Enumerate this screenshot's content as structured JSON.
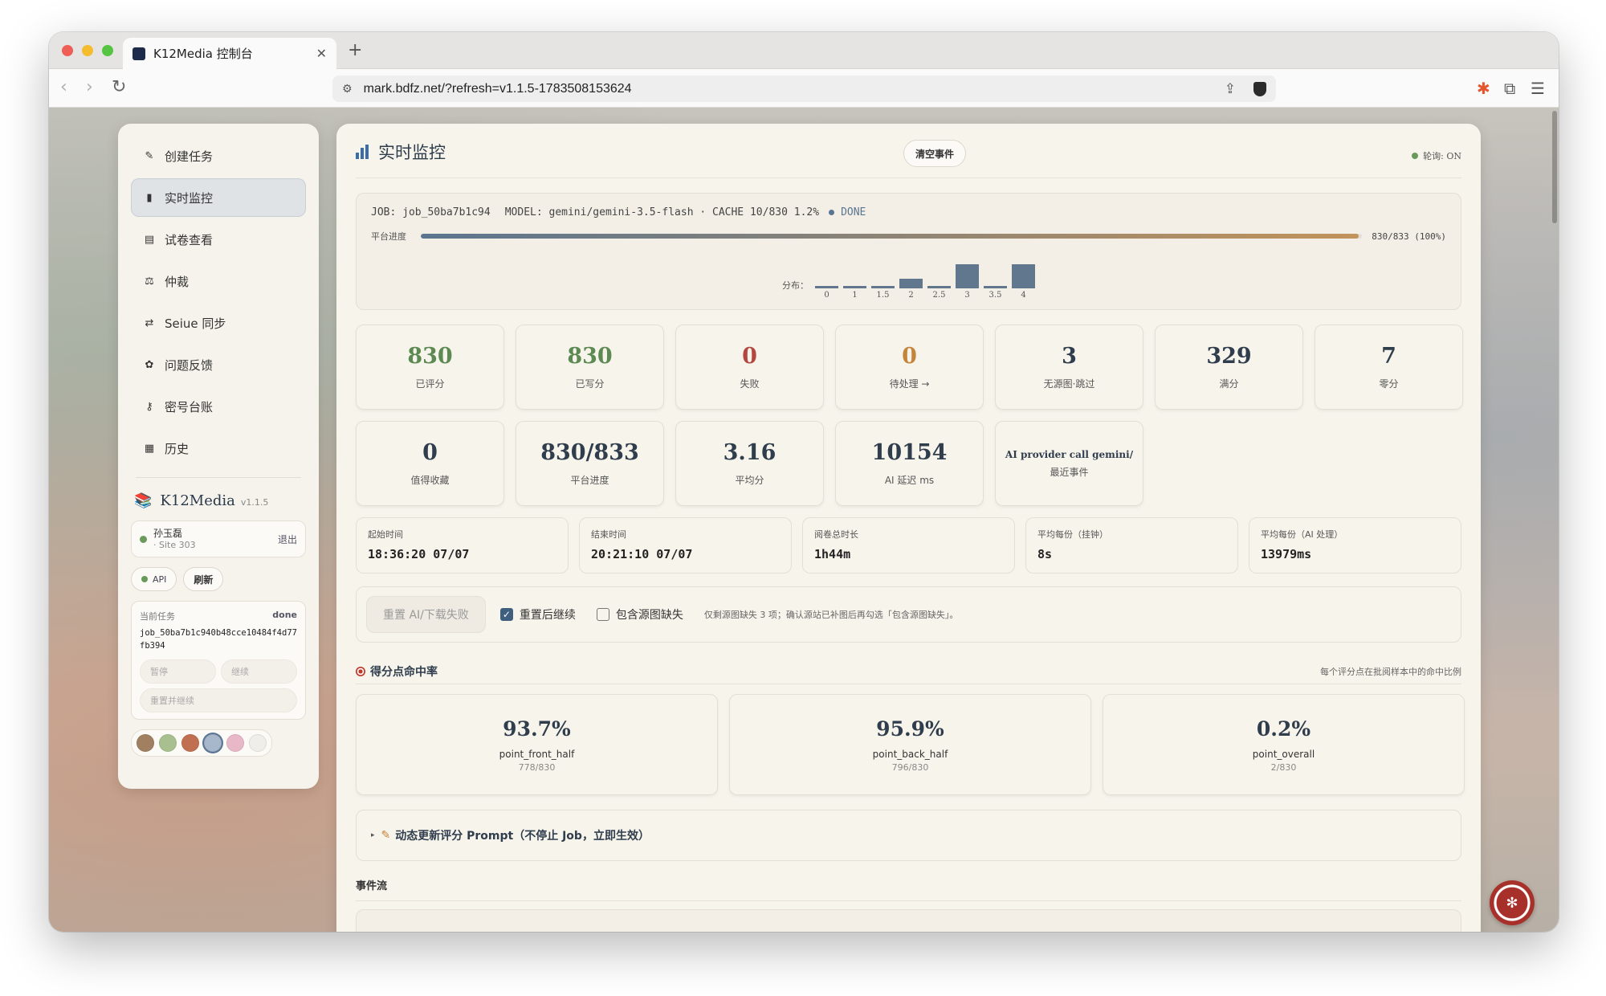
{
  "browser": {
    "tab_title": "K12Media 控制台",
    "url": "mark.bdfz.net/?refresh=v1.1.5-1783508153624"
  },
  "sidebar": {
    "items": [
      {
        "label": "创建任务",
        "icon": "pencil-icon"
      },
      {
        "label": "实时监控",
        "icon": "bar-chart-icon",
        "active": true
      },
      {
        "label": "试卷查看",
        "icon": "paper-icon"
      },
      {
        "label": "仲裁",
        "icon": "scale-icon"
      },
      {
        "label": "Seiue 同步",
        "icon": "sync-icon"
      },
      {
        "label": "问题反馈",
        "icon": "bug-icon"
      },
      {
        "label": "密号台账",
        "icon": "key-icon"
      },
      {
        "label": "历史",
        "icon": "history-icon"
      }
    ],
    "brand": {
      "name": "K12Media",
      "version": "v1.1.5"
    },
    "user": {
      "name": "孙玉磊",
      "site": "· Site 303",
      "logout": "退出"
    },
    "api_label": "API",
    "refresh_label": "刷新",
    "task": {
      "label": "当前任务",
      "status": "done",
      "id": "job_50ba7b1c940b48cce10484f4d77fb394",
      "pause": "暂停",
      "resume": "继续",
      "reset_resume": "重置并继续"
    },
    "swatches": [
      "#a08060",
      "#a8c090",
      "#c07050",
      "#a8b8cc",
      "#e8b8c8",
      "#f0eee8"
    ]
  },
  "main": {
    "title": "实时监控",
    "clear_events": "清空事件",
    "poll": "轮询: ON",
    "job": {
      "job": "JOB: job_50ba7b1c94",
      "model": "MODEL: gemini/gemini-3.5-flash · CACHE 10/830 1.2%",
      "status": "DONE",
      "progress_label": "平台进度",
      "progress_text": "830/833 (100%)",
      "progress_fraction": 0.996,
      "dist_label": "分布："
    },
    "stats": [
      {
        "value": "830",
        "label": "已评分",
        "tone": "green"
      },
      {
        "value": "830",
        "label": "已写分",
        "tone": "green"
      },
      {
        "value": "0",
        "label": "失败",
        "tone": "red"
      },
      {
        "value": "0",
        "label": "待处理 →",
        "tone": "orange"
      },
      {
        "value": "3",
        "label": "无源图·跳过",
        "tone": ""
      },
      {
        "value": "329",
        "label": "满分",
        "tone": ""
      },
      {
        "value": "7",
        "label": "零分",
        "tone": ""
      },
      {
        "value": "0",
        "label": "值得收藏",
        "tone": ""
      },
      {
        "value": "830/833",
        "label": "平台进度",
        "tone": ""
      },
      {
        "value": "3.16",
        "label": "平均分",
        "tone": ""
      },
      {
        "value": "10154",
        "label": "AI 延迟 ms",
        "tone": ""
      },
      {
        "value": "AI provider call gemini/",
        "label": "最近事件",
        "tone": "small"
      }
    ],
    "times": [
      {
        "label": "起始时间",
        "value": "18:36:20 07/07"
      },
      {
        "label": "结束时间",
        "value": "20:21:10 07/07"
      },
      {
        "label": "阅卷总时长",
        "value": "1h44m"
      },
      {
        "label": "平均每份（挂钟）",
        "value": "8s"
      },
      {
        "label": "平均每份（AI 处理）",
        "value": "13979ms"
      }
    ],
    "reset": {
      "button": "重置 AI/下载失败",
      "continue_label": "重置后继续",
      "include_label": "包含源图缺失",
      "note": "仅剩源图缺失 3 项；确认源站已补图后再勾选「包含源图缺失」。"
    },
    "hit_section": {
      "title": "得分点命中率",
      "note": "每个评分点在批阅样本中的命中比例",
      "items": [
        {
          "value": "93.7%",
          "name": "point_front_half",
          "sub": "778/830"
        },
        {
          "value": "95.9%",
          "name": "point_back_half",
          "sub": "796/830"
        },
        {
          "value": "0.2%",
          "name": "point_overall",
          "sub": "2/830"
        }
      ]
    },
    "prompt_label": "动态更新评分 Prompt（不停止 Job，立即生效）",
    "events_title": "事件流"
  },
  "chart_data": {
    "type": "bar",
    "categories": [
      "0",
      "1",
      "1.5",
      "2",
      "2.5",
      "3",
      "3.5",
      "4"
    ],
    "values": [
      1,
      1,
      1,
      4,
      1,
      10,
      1,
      10
    ]
  }
}
